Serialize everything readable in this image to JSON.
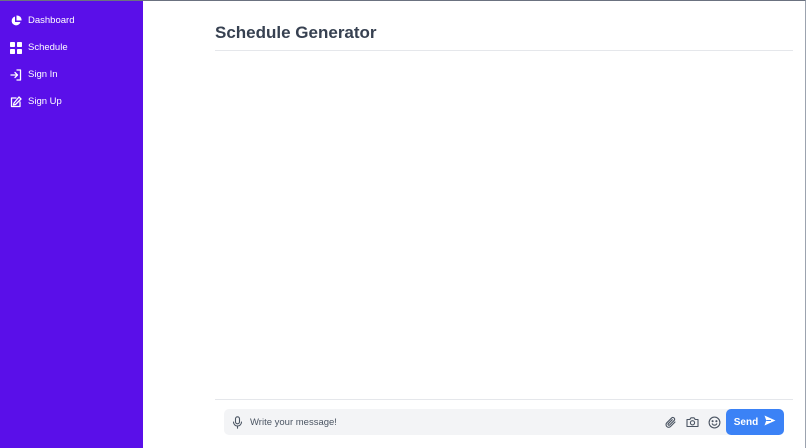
{
  "sidebar": {
    "items": [
      {
        "label": "Dashboard",
        "icon": "pie-chart-icon"
      },
      {
        "label": "Schedule",
        "icon": "grid-icon"
      },
      {
        "label": "Sign In",
        "icon": "sign-in-icon"
      },
      {
        "label": "Sign Up",
        "icon": "edit-icon"
      }
    ]
  },
  "main": {
    "title": "Schedule Generator"
  },
  "composer": {
    "placeholder": "Write your message!",
    "send_label": "Send",
    "icons": [
      "microphone-icon",
      "paperclip-icon",
      "camera-icon",
      "smiley-icon",
      "send-arrow-icon"
    ]
  },
  "colors": {
    "sidebar_bg": "#5a0fe9",
    "accent": "#3b82f6",
    "title_text": "#374151"
  }
}
